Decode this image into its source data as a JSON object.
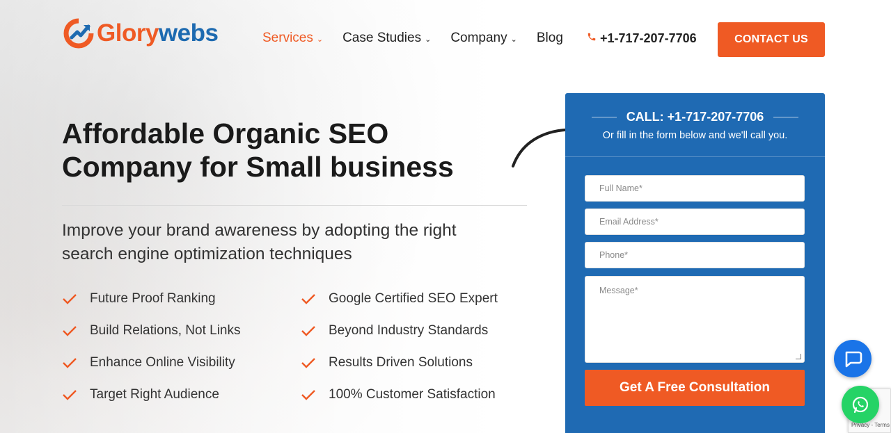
{
  "brand": {
    "logo_part1": "Glory",
    "logo_part2": "webs",
    "orange": "#ef5a24",
    "blue": "#1d6ab0"
  },
  "nav": {
    "items": [
      {
        "label": "Services",
        "dropdown": true,
        "active": true
      },
      {
        "label": "Case Studies",
        "dropdown": true,
        "active": false
      },
      {
        "label": "Company",
        "dropdown": true,
        "active": false
      },
      {
        "label": "Blog",
        "dropdown": false,
        "active": false
      }
    ],
    "phone": "+1-717-207-7706",
    "phone_icon": "phone-icon",
    "cta": "CONTACT US"
  },
  "hero": {
    "title_line1": "Affordable Organic SEO",
    "title_line2": "Company for Small business",
    "subtitle": "Improve your brand awareness by adopting the right search engine optimization techniques",
    "features": [
      "Future Proof Ranking",
      "Google Certified SEO Expert",
      "Build Relations, Not Links",
      "Beyond Industry Standards",
      "Enhance Online Visibility",
      "Results Driven Solutions",
      "Target Right Audience",
      "100% Customer Satisfaction"
    ]
  },
  "form": {
    "call_label": "CALL: +1-717-207-7706",
    "call_sub": "Or fill in the form below and we'll call you.",
    "name_placeholder": "Full Name*",
    "email_placeholder": "Email Address*",
    "phone_placeholder": "Phone*",
    "message_placeholder": "Message*",
    "submit": "Get A Free Consultation",
    "panel_color": "#1f6ab3"
  },
  "floating": {
    "chat_icon": "chat-bubble-icon",
    "whatsapp_icon": "whatsapp-icon",
    "recaptcha_text": "Privacy - Terms"
  }
}
